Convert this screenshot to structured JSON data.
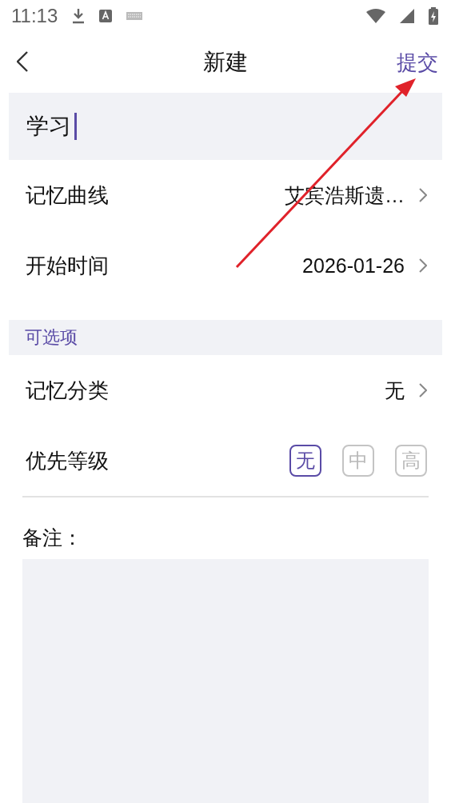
{
  "status_bar": {
    "time": "11:13"
  },
  "header": {
    "title": "新建",
    "action": "提交"
  },
  "title_field": {
    "value": "学习"
  },
  "rows": [
    {
      "label": "记忆曲线",
      "value": "艾宾浩斯遗…"
    },
    {
      "label": "开始时间",
      "value": "2026-01-26"
    }
  ],
  "section": {
    "title": "可选项"
  },
  "optional_rows": [
    {
      "kind": "select",
      "label": "记忆分类",
      "value": "无"
    },
    {
      "kind": "priority",
      "label": "优先等级",
      "options": [
        {
          "label": "无",
          "selected": true
        },
        {
          "label": "中",
          "selected": false
        },
        {
          "label": "高",
          "selected": false
        }
      ]
    }
  ],
  "notes": {
    "label": "备注："
  }
}
